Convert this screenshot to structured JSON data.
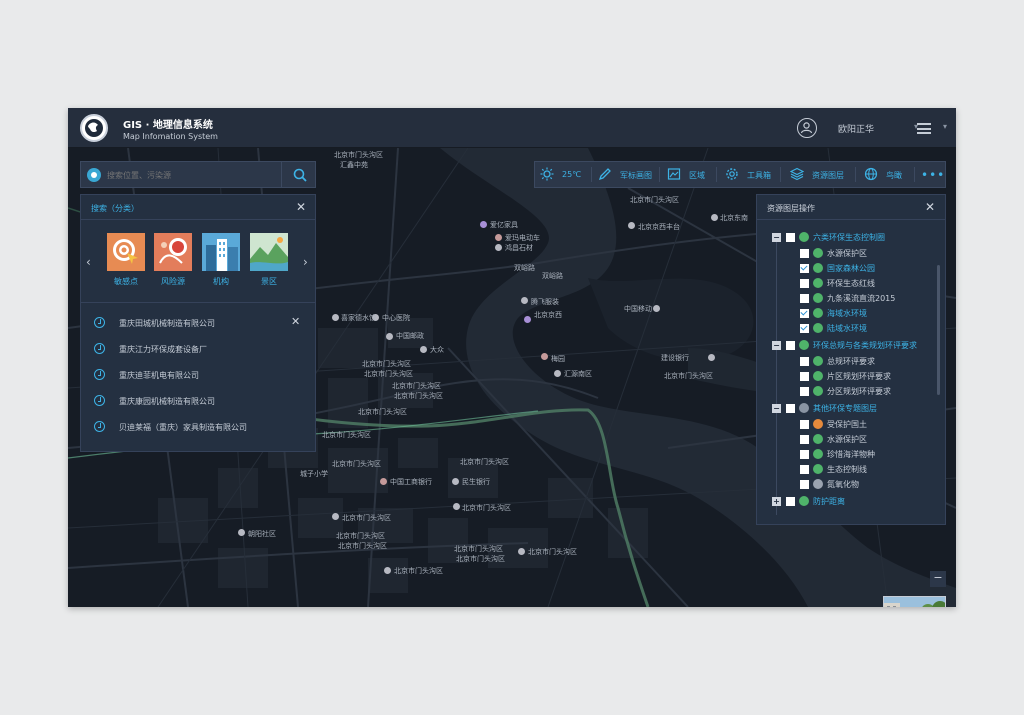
{
  "header": {
    "title": "GIS · 地理信息系统",
    "subtitle": "Map Infomation System",
    "user_name": "欧阳正华"
  },
  "search": {
    "placeholder": "搜索位置、污染源",
    "value": ""
  },
  "search_panel": {
    "title": "搜索（分类）",
    "categories": [
      {
        "label": "敏感点",
        "icon": "target-cursor-icon"
      },
      {
        "label": "风险源",
        "icon": "risk-source-icon"
      },
      {
        "label": "机构",
        "icon": "building-icon"
      },
      {
        "label": "景区",
        "icon": "landscape-icon"
      }
    ],
    "history": [
      "重庆田城机械制造有限公司",
      "重庆江力环保成套设备厂",
      "重庆迪菲机电有限公司",
      "重庆康园机械制造有限公司",
      "贝迪莱福（重庆）家具制造有限公司"
    ]
  },
  "toolbar": {
    "weather": "25℃",
    "items": [
      "军标画图",
      "区域",
      "工具箱",
      "资源图层",
      "鸟瞰"
    ]
  },
  "layer_panel": {
    "title": "资源图层操作",
    "groups": [
      {
        "label": "六类环保生态控制圈",
        "items": [
          {
            "label": "水源保护区",
            "checked": false
          },
          {
            "label": "国家森林公园",
            "checked": true
          },
          {
            "label": "环保生态红线",
            "checked": false
          },
          {
            "label": "九条溪流直流2015",
            "checked": false
          },
          {
            "label": "海域水环境",
            "checked": true
          },
          {
            "label": "陆域水环境",
            "checked": true
          }
        ]
      },
      {
        "label": "环保总规与各类规划环评要求",
        "items": [
          {
            "label": "总规环评要求",
            "checked": false
          },
          {
            "label": "片区规划环评要求",
            "checked": false
          },
          {
            "label": "分区规划环评要求",
            "checked": false
          }
        ]
      },
      {
        "label": "其他环保专题图层",
        "items": [
          {
            "label": "受保护国土",
            "checked": false
          },
          {
            "label": "水源保护区",
            "checked": false
          },
          {
            "label": "珍惜海洋物种",
            "checked": false
          },
          {
            "label": "生态控制线",
            "checked": false
          },
          {
            "label": "氮氧化物",
            "checked": false
          }
        ]
      },
      {
        "label": "防护距离",
        "items": []
      }
    ]
  },
  "map": {
    "labels": [
      "北京市门头沟区",
      "汇鑫中苑",
      "爱亿家具",
      "爱玛电动车",
      "鸿昌石材",
      "北京京西丰台",
      "北京市门头沟区",
      "双峪路",
      "双峪路",
      "腾飞服装",
      "北京京西",
      "中国移动",
      "北京东南",
      "梅园",
      "汇源南区",
      "建设银行",
      "北京市门头沟区",
      "中心医院",
      "喜家德水饺",
      "中国邮政",
      "大众",
      "北京市门头沟区",
      "北京市门头沟区",
      "北京市门头沟区",
      "北京市门头沟区",
      "北京市门头沟区",
      "北京市门头沟区",
      "北京市门头沟区",
      "城子小学",
      "中国工商银行",
      "北京市门头沟区",
      "民生银行",
      "北京市门头沟区",
      "朝阳社区",
      "北京市门头沟区",
      "北京市门头沟区",
      "北京市门头沟区",
      "北京市门头沟区",
      "北京市门头沟区",
      "北京市门头沟区",
      "北京市门头沟区"
    ],
    "zoom_out": "−",
    "panorama_label": "全景"
  }
}
